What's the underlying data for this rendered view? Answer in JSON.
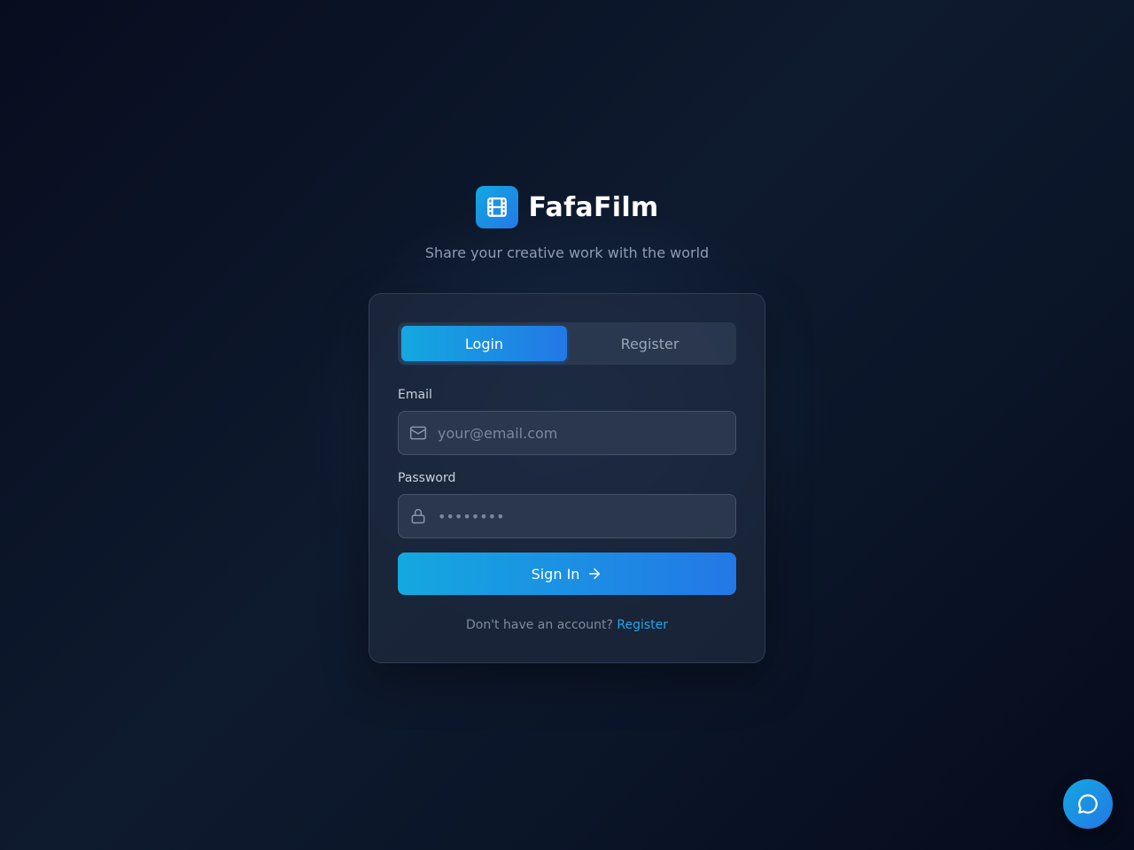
{
  "brand": {
    "name": "FafaFilm",
    "tagline": "Share your creative work with the world",
    "logo_icon": "film-icon"
  },
  "auth": {
    "tabs": [
      {
        "label": "Login",
        "active": true
      },
      {
        "label": "Register",
        "active": false
      }
    ],
    "email": {
      "label": "Email",
      "placeholder": "your@email.com",
      "value": "",
      "icon": "mail-icon"
    },
    "password": {
      "label": "Password",
      "placeholder": "••••••••",
      "value": "",
      "icon": "lock-icon"
    },
    "submit": {
      "label": "Sign In",
      "icon": "arrow-right-icon"
    },
    "footer": {
      "prompt": "Don't have an account?",
      "link": "Register"
    }
  },
  "chat": {
    "icon": "chat-bubble-icon"
  },
  "colors": {
    "accent_start": "#14a8e0",
    "accent_end": "#2378e6",
    "link": "#22a6e8",
    "background": "#0b1528"
  }
}
